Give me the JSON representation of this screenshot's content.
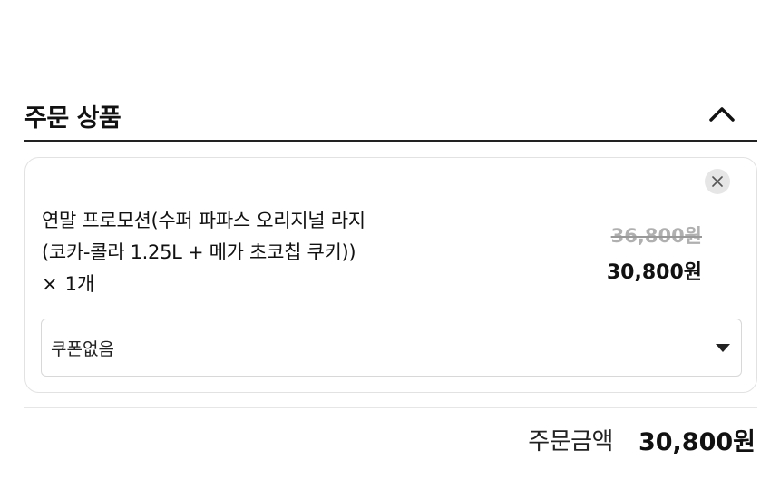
{
  "section": {
    "title": "주문 상품",
    "collapse_icon": "chevron-up-icon"
  },
  "item": {
    "name_line1": "연말 프로모션(수퍼 파파스 오리지널 라지",
    "name_line2": "(코카-콜라 1.25L + 메가 초코칩 쿠키))",
    "quantity_prefix": "×",
    "quantity": "1개",
    "original_price": "36,800원",
    "final_price": "30,800원",
    "remove_icon": "close-icon"
  },
  "coupon": {
    "selected": "쿠폰없음",
    "dropdown_icon": "caret-down-icon"
  },
  "total": {
    "label": "주문금액",
    "value": "30,800원"
  },
  "colors": {
    "text": "#111111",
    "strikethrough": "#b0b0b0",
    "border": "#e2e2e2",
    "remove_bg": "#e6e6e6"
  }
}
